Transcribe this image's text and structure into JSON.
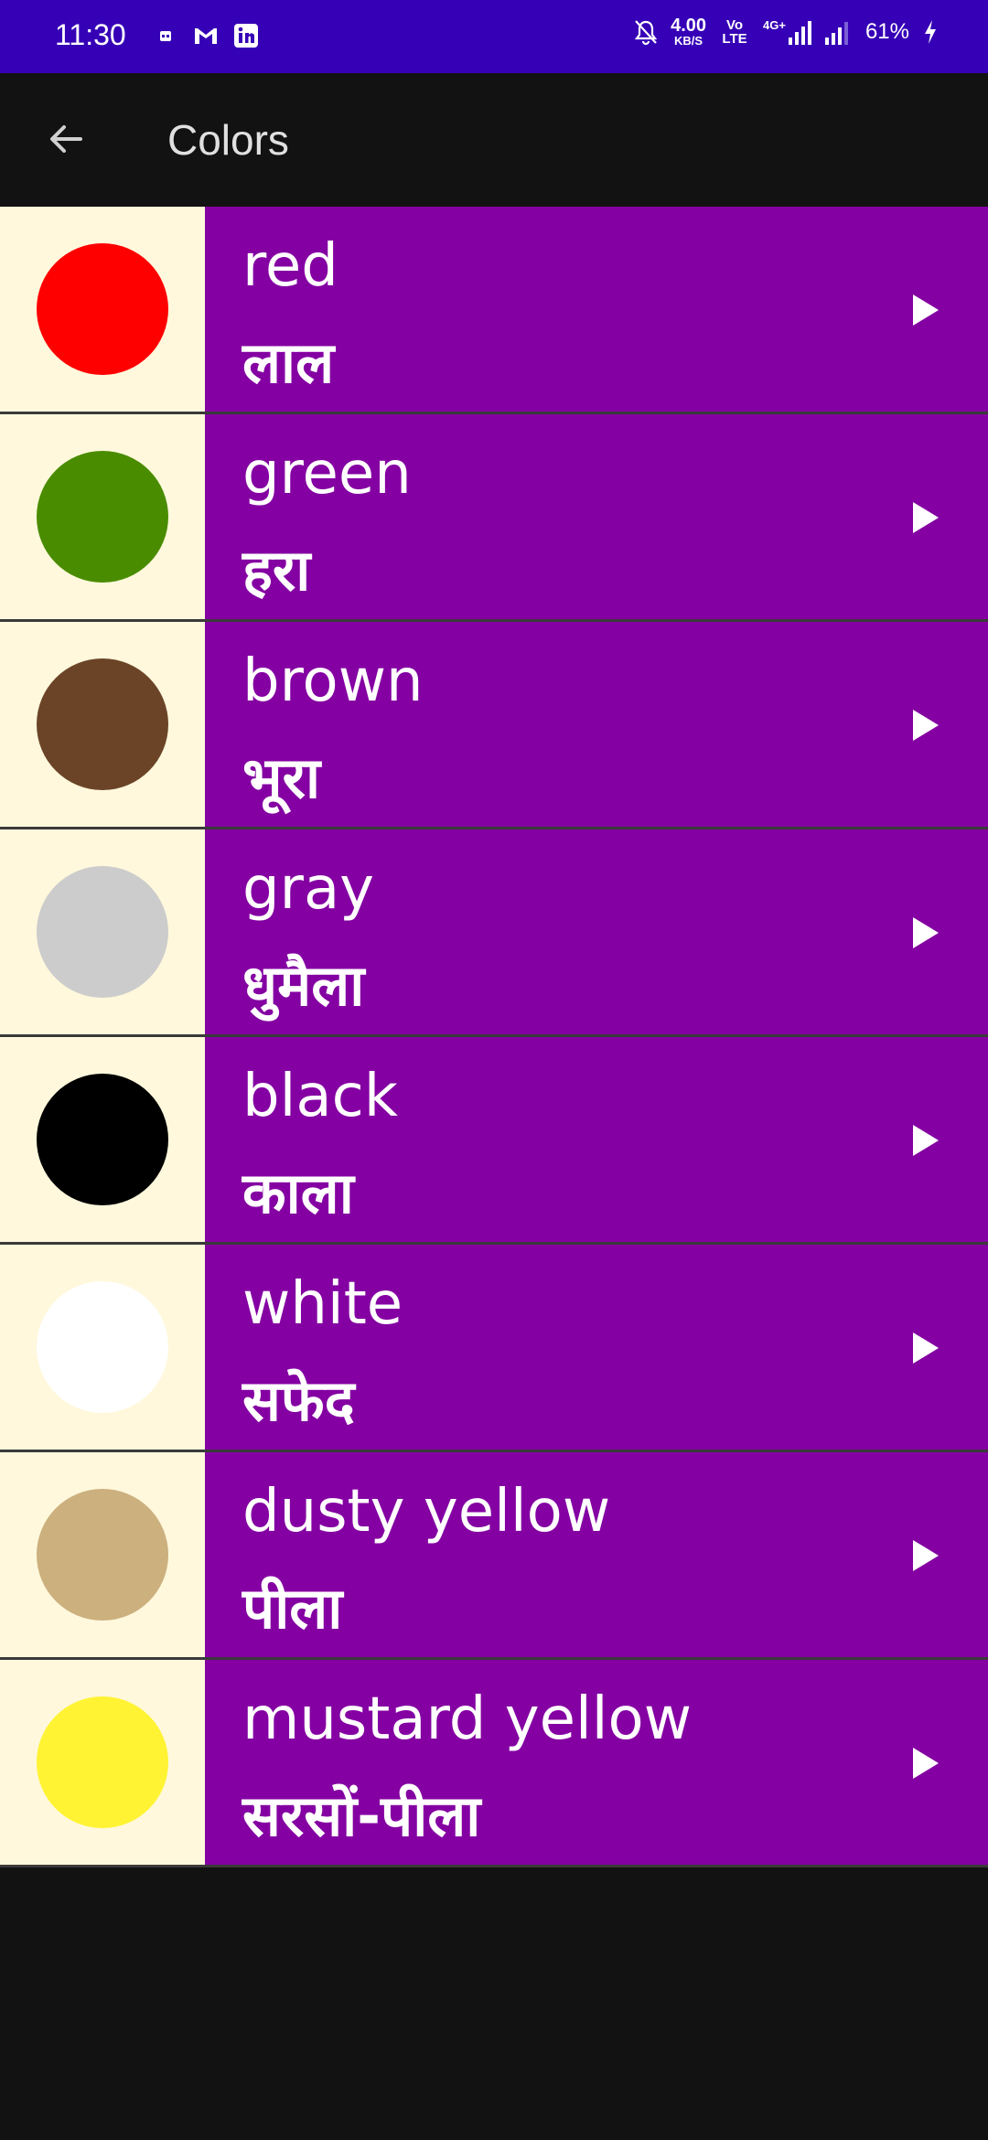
{
  "status_bar": {
    "time": "11:30",
    "net_speed_value": "4.00",
    "net_speed_unit": "KB/S",
    "volte_tag": "Vo LTE",
    "network_tag": "4G+",
    "battery": "61%",
    "icons": [
      "calendar-icon",
      "gmail-icon",
      "linkedin-icon",
      "mute-bell-icon",
      "signal-icon",
      "signal-icon-2",
      "charging-bolt-icon"
    ]
  },
  "app_bar": {
    "title": "Colors",
    "back_icon": "arrow-left-icon"
  },
  "colors": [
    {
      "english": "red",
      "hindi": "लाल",
      "swatch": "#ff0000"
    },
    {
      "english": "green",
      "hindi": "हरा",
      "swatch": "#4a8c00"
    },
    {
      "english": "brown",
      "hindi": "भूरा",
      "swatch": "#6b4427"
    },
    {
      "english": "gray",
      "hindi": "धुमैला",
      "swatch": "#cccccc"
    },
    {
      "english": "black",
      "hindi": "काला",
      "swatch": "#000000"
    },
    {
      "english": "white",
      "hindi": "सफेद",
      "swatch": "#ffffff"
    },
    {
      "english": "dusty yellow",
      "hindi": "पीला",
      "swatch": "#ccb07e"
    },
    {
      "english": "mustard yellow",
      "hindi": "सरसों-पीला",
      "swatch": "#fff333"
    }
  ],
  "theme": {
    "status_bar_bg": "#3600b6",
    "app_bar_bg": "#121212",
    "row_bg": "#8400a2",
    "swatch_cell_bg": "#fff8dc",
    "play_icon": "play-icon"
  }
}
